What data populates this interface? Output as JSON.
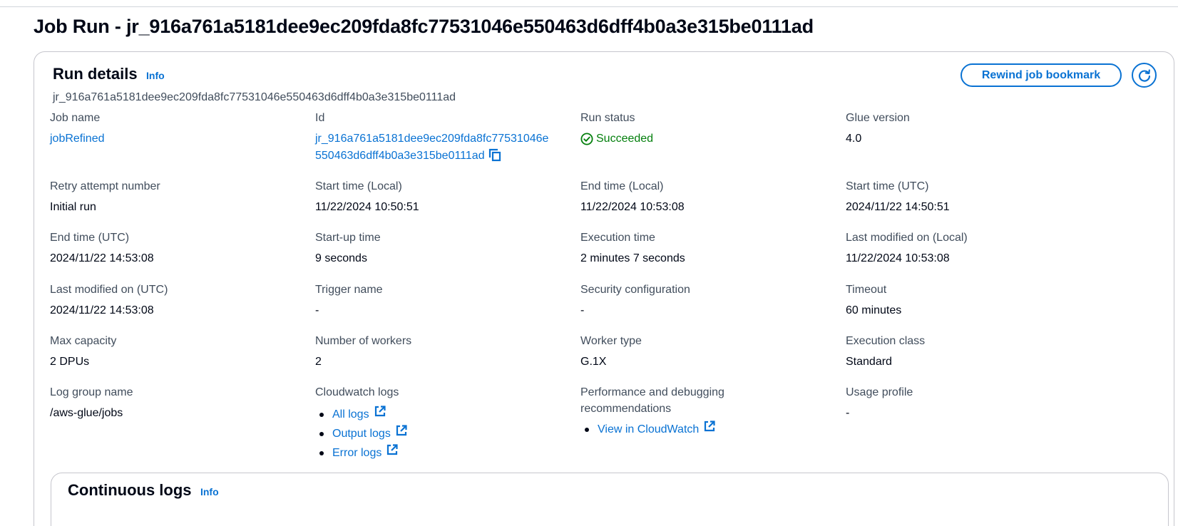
{
  "page": {
    "title": "Job Run - jr_916a761a5181dee9ec209fda8fc77531046e550463d6dff4b0a3e315be0111ad"
  },
  "run_details": {
    "heading": "Run details",
    "info_label": "Info",
    "run_id": "jr_916a761a5181dee9ec209fda8fc77531046e550463d6dff4b0a3e315be0111ad",
    "rewind_button": "Rewind job bookmark",
    "refresh_icon": "refresh-icon",
    "fields": {
      "job_name": {
        "label": "Job name",
        "value": "jobRefined"
      },
      "id": {
        "label": "Id",
        "value_line1": "jr_916a761a5181dee9ec209fda8fc77531046e",
        "value_line2": "550463d6dff4b0a3e315be0111ad",
        "copy_icon": "copy-icon"
      },
      "run_status": {
        "label": "Run status",
        "value": "Succeeded",
        "icon": "check-circle-icon",
        "color": "#037f0c"
      },
      "glue_version": {
        "label": "Glue version",
        "value": "4.0"
      },
      "retry_attempt": {
        "label": "Retry attempt number",
        "value": "Initial run"
      },
      "start_local": {
        "label": "Start time (Local)",
        "value": "11/22/2024 10:50:51"
      },
      "end_local": {
        "label": "End time (Local)",
        "value": "11/22/2024 10:53:08"
      },
      "start_utc": {
        "label": "Start time (UTC)",
        "value": "2024/11/22 14:50:51"
      },
      "end_utc": {
        "label": "End time (UTC)",
        "value": "2024/11/22 14:53:08"
      },
      "startup_time": {
        "label": "Start-up time",
        "value": "9 seconds"
      },
      "execution_time": {
        "label": "Execution time",
        "value": "2 minutes 7 seconds"
      },
      "last_modified_local": {
        "label": "Last modified on (Local)",
        "value": "11/22/2024 10:53:08"
      },
      "last_modified_utc": {
        "label": "Last modified on (UTC)",
        "value": "2024/11/22 14:53:08"
      },
      "trigger_name": {
        "label": "Trigger name",
        "value": "-"
      },
      "security_config": {
        "label": "Security configuration",
        "value": "-"
      },
      "timeout": {
        "label": "Timeout",
        "value": "60 minutes"
      },
      "max_capacity": {
        "label": "Max capacity",
        "value": "2 DPUs"
      },
      "num_workers": {
        "label": "Number of workers",
        "value": "2"
      },
      "worker_type": {
        "label": "Worker type",
        "value": "G.1X"
      },
      "execution_class": {
        "label": "Execution class",
        "value": "Standard"
      },
      "log_group": {
        "label": "Log group name",
        "value": "/aws-glue/jobs"
      },
      "cloudwatch_logs": {
        "label": "Cloudwatch logs",
        "links": [
          "All logs",
          "Output logs",
          "Error logs"
        ],
        "link_icon": "external-link-icon"
      },
      "perf_debug": {
        "label_line1": "Performance and debugging",
        "label_line2": "recommendations",
        "link": "View in CloudWatch",
        "link_icon": "external-link-icon"
      },
      "usage_profile": {
        "label": "Usage profile",
        "value": "-"
      }
    }
  },
  "continuous_logs": {
    "heading": "Continuous logs",
    "info_label": "Info"
  },
  "colors": {
    "link": "#0972d3",
    "success": "#037f0c",
    "label": "#414d5c",
    "text": "#000716",
    "border": "#c6c6cd"
  }
}
